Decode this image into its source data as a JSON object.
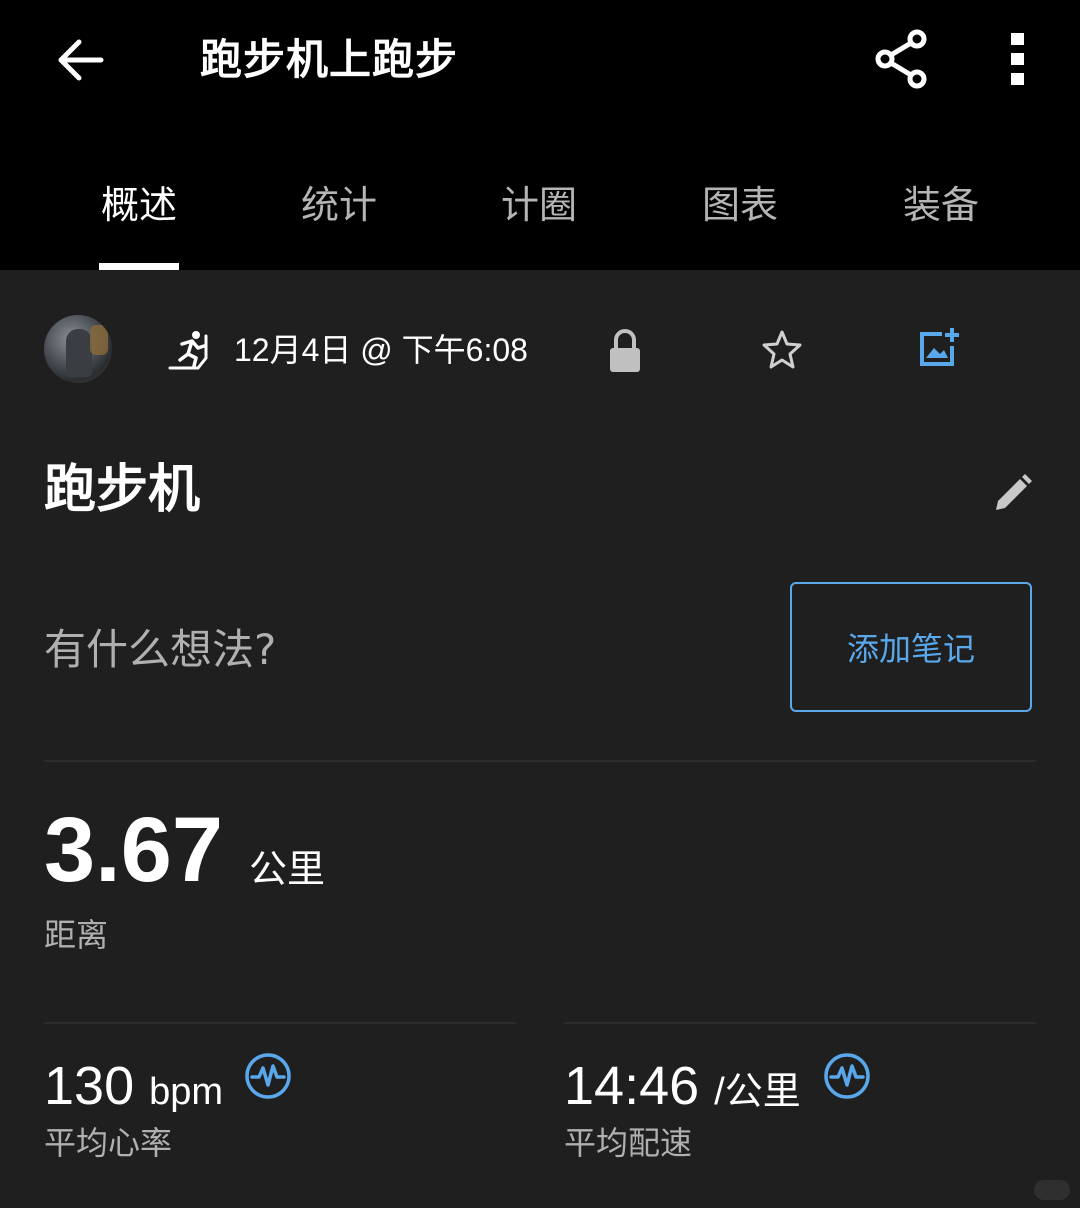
{
  "header": {
    "title": "跑步机上跑步",
    "back_icon": "arrow-left-icon",
    "share_icon": "share-icon",
    "more_icon": "more-vertical-icon"
  },
  "tabs": [
    {
      "label": "概述",
      "active": true
    },
    {
      "label": "统计",
      "active": false
    },
    {
      "label": "计圈",
      "active": false
    },
    {
      "label": "图表",
      "active": false
    },
    {
      "label": "装备",
      "active": false
    }
  ],
  "meta": {
    "datetime": "12月4日 @ 下午6:08",
    "activity_icon": "treadmill-run-icon",
    "privacy_icon": "lock-icon",
    "favorite_icon": "star-outline-icon",
    "add_photo_icon": "add-photo-icon"
  },
  "activity": {
    "name": "跑步机",
    "edit_icon": "pencil-icon"
  },
  "notes": {
    "prompt": "有什么想法?",
    "add_button_label": "添加笔记"
  },
  "distance": {
    "value": "3.67",
    "unit": "公里",
    "label": "距离"
  },
  "stats": [
    {
      "value": "130",
      "unit": "bpm",
      "label": "平均心率",
      "icon": "pulse-icon"
    },
    {
      "value": "14:46",
      "unit": "/公里",
      "label": "平均配速",
      "icon": "pulse-icon"
    }
  ],
  "colors": {
    "accent": "#5aa8ec",
    "background": "#1f1f1f",
    "topbar": "#000000"
  }
}
